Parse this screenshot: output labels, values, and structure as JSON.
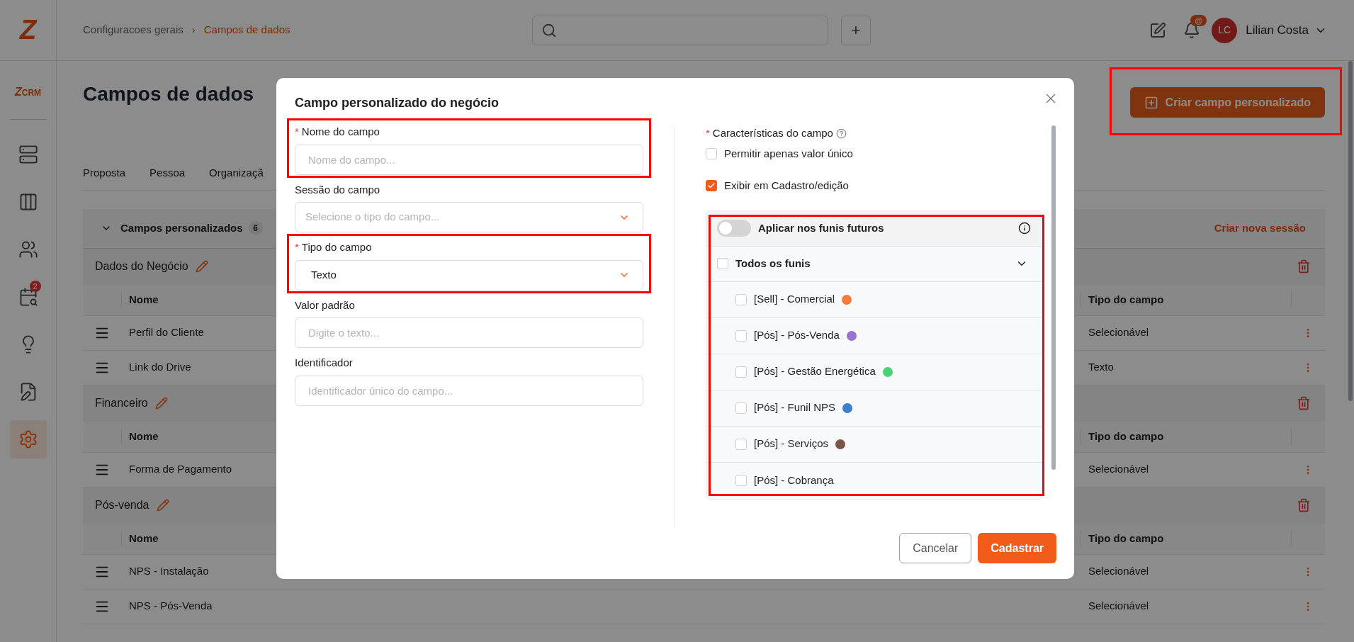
{
  "header": {
    "logo": "Z",
    "breadcrumb": [
      {
        "label": "Configuracoes gerais",
        "current": false
      },
      {
        "label": "Campos de dados",
        "current": true
      }
    ],
    "separator": "›",
    "add_button": "+",
    "mention_badge": "@",
    "user": {
      "initials": "LC",
      "name": "Lilian Costa"
    }
  },
  "sidebar": {
    "brand_mark": "Z",
    "brand_text": "CRM",
    "items": [
      {
        "kind": "servers",
        "selected": false
      },
      {
        "kind": "board",
        "selected": false
      },
      {
        "kind": "people",
        "selected": false
      },
      {
        "kind": "calendar",
        "selected": false,
        "badge": "2"
      },
      {
        "kind": "ideas",
        "selected": false
      },
      {
        "kind": "notes",
        "selected": false
      },
      {
        "kind": "settings",
        "selected": true
      }
    ]
  },
  "page": {
    "title": "Campos de dados",
    "create_button": {
      "label": "Criar campo personalizado",
      "highlighted": true
    },
    "tabs": [
      "Proposta",
      "Pessoa",
      "Organizaçã"
    ],
    "section": {
      "title": "Campos personalizados",
      "count": "6",
      "action": "Criar nova sessão",
      "expanded": true
    },
    "groups": [
      {
        "name": "Dados do Negócio",
        "columns": [
          "Nome",
          "Tipo do campo"
        ],
        "rows": [
          {
            "name": "Perfil do Cliente",
            "type": "Selecionável"
          },
          {
            "name": "Link do Drive",
            "type": "Texto"
          }
        ]
      },
      {
        "name": "Financeiro",
        "columns": [
          "Nome",
          "Tipo do campo"
        ],
        "rows": [
          {
            "name": "Forma de Pagamento",
            "type": "Selecionável"
          }
        ]
      },
      {
        "name": "Pós-venda",
        "columns": [
          "Nome",
          "Tipo do campo"
        ],
        "rows": [
          {
            "name": "NPS - Instalação",
            "type": "Selecionável"
          },
          {
            "name": "NPS - Pós-Venda",
            "type": "Selecionável"
          }
        ]
      }
    ]
  },
  "modal": {
    "title": "Campo personalizado do negócio",
    "required_mark": "*",
    "fields": [
      {
        "label": "Nome do campo",
        "required": true,
        "kind": "input",
        "placeholder": "Nome do campo...",
        "highlighted": true
      },
      {
        "label": "Sessão do campo",
        "required": false,
        "kind": "select",
        "placeholder": "Selecione o tipo do campo...",
        "highlighted": false
      },
      {
        "label": "Tipo do campo",
        "required": true,
        "kind": "select",
        "value": "Texto",
        "highlighted": true
      },
      {
        "label": "Valor padrão",
        "required": false,
        "kind": "input",
        "placeholder": "Digite o texto...",
        "highlighted": false
      },
      {
        "label": "Identificador",
        "required": false,
        "kind": "input",
        "placeholder": "Identificador único do campo...",
        "highlighted": false
      }
    ],
    "characteristics": {
      "label": "Características do campo",
      "required": true,
      "options": [
        {
          "label": "Permitir apenas valor único",
          "checked": false
        },
        {
          "label": "Exibir em Cadastro/edição",
          "checked": true
        }
      ]
    },
    "funnels": {
      "highlighted": true,
      "future": {
        "label": "Aplicar nos funis futuros",
        "on": false
      },
      "all": {
        "label": "Todos os funis",
        "checked": false,
        "expanded": true
      },
      "items": [
        {
          "label": "[Sell] - Comercial",
          "checked": false,
          "color": "#f47c3c"
        },
        {
          "label": "[Pós] - Pós-Venda",
          "checked": false,
          "color": "#9b72cf"
        },
        {
          "label": "[Pós] - Gestão Energética",
          "checked": false,
          "color": "#4cd17a"
        },
        {
          "label": "[Pós] - Funil NPS",
          "checked": false,
          "color": "#3a7fd0"
        },
        {
          "label": "[Pós] - Serviços",
          "checked": false,
          "color": "#7a5548"
        },
        {
          "label": "[Pós] - Cobrança",
          "checked": false
        }
      ]
    },
    "buttons": [
      {
        "label": "Cancelar",
        "kind": "secondary"
      },
      {
        "label": "Cadastrar",
        "kind": "primary"
      }
    ]
  }
}
